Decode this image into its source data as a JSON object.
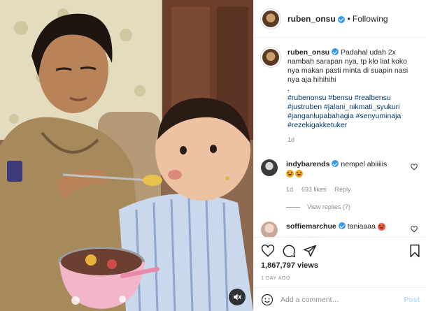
{
  "post": {
    "username": "ruben_onsu",
    "follow_status": "Following",
    "separator": "•"
  },
  "caption": {
    "username": "ruben_onsu",
    "text": "Padahal udah 2x nambah sarapan nya, tp klo liat koko nya makan pasti minta di suapin nasi nya aja hihihihi",
    "dot_line": ".",
    "hashtags": "#rubenonsu #bensu #realbensu #justruben #jalani_nikmati_syukuri #janganlupabahagia #senyuminaja #rezekigakketuker",
    "age": "1d"
  },
  "comments": [
    {
      "username": "indybarends",
      "text": "nempel abiiiiis",
      "emojis": [
        "smile",
        "smile"
      ],
      "age": "1d",
      "likes": "693 likes",
      "reply_label": "Reply",
      "view_replies": "View replies (7)"
    },
    {
      "username": "soffiemarchue",
      "text": "taniaaaa",
      "emojis": [
        "heart-eyes"
      ],
      "partial_text": "... ..... ........"
    }
  ],
  "stats": {
    "views": "1,867,797 views",
    "time": "1 DAY AGO"
  },
  "add_comment": {
    "placeholder": "Add a comment…",
    "post_label": "Post"
  },
  "colors": {
    "verified": "#3897f0",
    "link": "#00376b",
    "muted": "#8e8e8e",
    "post_disabled": "#b2dffc"
  },
  "icons": [
    "verified-icon",
    "heart-icon",
    "comment-icon",
    "share-icon",
    "bookmark-icon",
    "smile-icon",
    "mute-icon"
  ]
}
